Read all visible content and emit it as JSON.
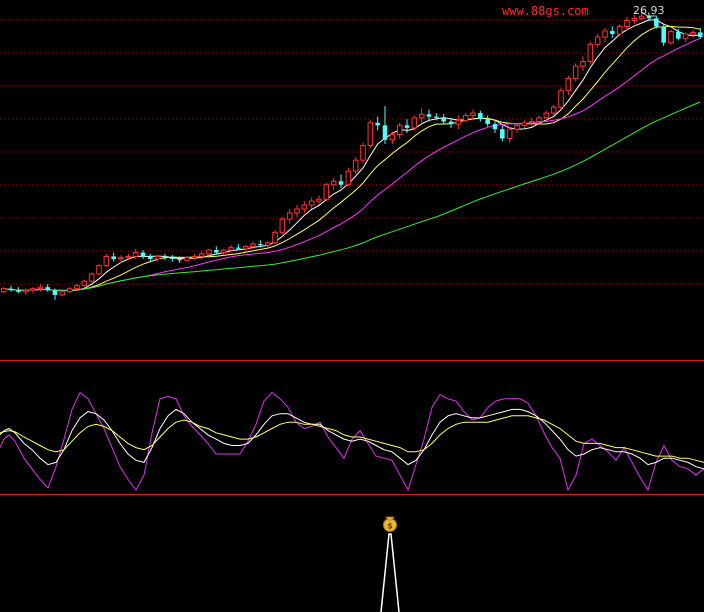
{
  "watermark": "www.88gs.com",
  "chart_data": [
    {
      "type": "candlestick",
      "panel": "price",
      "title": "",
      "peak_label": "26.93",
      "ylim": [
        5.0,
        27.2
      ],
      "grid": true,
      "candles": [
        [
          0,
          5.95,
          6.1,
          5.9,
          6.05
        ],
        [
          1,
          6.05,
          6.15,
          5.95,
          6.0
        ],
        [
          2,
          6.0,
          6.1,
          5.9,
          5.95
        ],
        [
          3,
          5.95,
          6.05,
          5.85,
          6.0
        ],
        [
          4,
          6.0,
          6.1,
          5.9,
          6.05
        ],
        [
          5,
          6.05,
          6.2,
          5.95,
          6.1
        ],
        [
          6,
          6.1,
          6.2,
          5.95,
          6.0
        ],
        [
          7,
          6.0,
          6.05,
          5.7,
          5.85
        ],
        [
          8,
          5.85,
          6.0,
          5.8,
          5.95
        ],
        [
          9,
          5.95,
          6.1,
          5.9,
          6.05
        ],
        [
          10,
          6.05,
          6.2,
          6.0,
          6.15
        ],
        [
          11,
          6.15,
          6.35,
          6.1,
          6.3
        ],
        [
          12,
          6.3,
          6.6,
          6.25,
          6.55
        ],
        [
          13,
          6.55,
          6.9,
          6.5,
          6.85
        ],
        [
          14,
          6.85,
          7.3,
          6.8,
          7.2
        ],
        [
          15,
          7.2,
          7.35,
          7.0,
          7.1
        ],
        [
          16,
          7.1,
          7.25,
          6.95,
          7.15
        ],
        [
          17,
          7.15,
          7.3,
          7.05,
          7.2
        ],
        [
          18,
          7.2,
          7.5,
          7.1,
          7.35
        ],
        [
          19,
          7.35,
          7.45,
          7.1,
          7.2
        ],
        [
          20,
          7.2,
          7.3,
          7.0,
          7.1
        ],
        [
          21,
          7.1,
          7.25,
          7.0,
          7.2
        ],
        [
          22,
          7.2,
          7.3,
          7.05,
          7.15
        ],
        [
          23,
          7.15,
          7.25,
          7.0,
          7.1
        ],
        [
          24,
          7.1,
          7.2,
          6.95,
          7.05
        ],
        [
          25,
          7.05,
          7.2,
          7.0,
          7.15
        ],
        [
          26,
          7.15,
          7.3,
          7.05,
          7.2
        ],
        [
          27,
          7.2,
          7.4,
          7.1,
          7.3
        ],
        [
          28,
          7.3,
          7.5,
          7.2,
          7.45
        ],
        [
          29,
          7.45,
          7.6,
          7.3,
          7.35
        ],
        [
          30,
          7.35,
          7.5,
          7.25,
          7.45
        ],
        [
          31,
          7.45,
          7.65,
          7.35,
          7.55
        ],
        [
          32,
          7.55,
          7.7,
          7.45,
          7.5
        ],
        [
          33,
          7.5,
          7.65,
          7.4,
          7.6
        ],
        [
          34,
          7.6,
          7.8,
          7.5,
          7.7
        ],
        [
          35,
          7.7,
          7.85,
          7.55,
          7.65
        ],
        [
          36,
          7.65,
          7.8,
          7.55,
          7.75
        ],
        [
          37,
          7.75,
          8.3,
          7.7,
          8.2
        ],
        [
          38,
          8.2,
          8.9,
          8.1,
          8.8
        ],
        [
          39,
          8.8,
          9.3,
          8.6,
          9.1
        ],
        [
          40,
          9.1,
          9.5,
          8.9,
          9.3
        ],
        [
          41,
          9.3,
          9.7,
          9.1,
          9.5
        ],
        [
          42,
          9.5,
          9.9,
          9.3,
          9.7
        ],
        [
          43,
          9.7,
          10.0,
          9.5,
          9.8
        ],
        [
          44,
          9.8,
          10.7,
          9.7,
          10.6
        ],
        [
          45,
          10.6,
          11.0,
          10.3,
          10.8
        ],
        [
          46,
          10.8,
          11.2,
          10.4,
          10.6
        ],
        [
          47,
          10.6,
          11.6,
          10.5,
          11.4
        ],
        [
          48,
          11.4,
          12.3,
          11.2,
          12.1
        ],
        [
          49,
          12.1,
          13.3,
          11.9,
          13.1
        ],
        [
          50,
          13.1,
          15.0,
          12.9,
          14.8
        ],
        [
          51,
          14.8,
          15.3,
          14.2,
          14.6
        ],
        [
          52,
          14.6,
          16.2,
          13.2,
          13.5
        ],
        [
          53,
          13.5,
          14.1,
          13.2,
          13.9
        ],
        [
          54,
          13.9,
          14.8,
          13.6,
          14.6
        ],
        [
          55,
          14.6,
          15.1,
          14.0,
          14.4
        ],
        [
          56,
          14.4,
          15.4,
          14.2,
          15.2
        ],
        [
          57,
          15.2,
          16.0,
          14.8,
          15.5
        ],
        [
          58,
          15.5,
          15.9,
          14.9,
          15.3
        ],
        [
          59,
          15.3,
          15.6,
          15.0,
          15.2
        ],
        [
          60,
          15.2,
          15.5,
          14.7,
          14.9
        ],
        [
          61,
          14.9,
          15.2,
          14.4,
          14.7
        ],
        [
          62,
          14.7,
          15.4,
          14.3,
          15.0
        ],
        [
          63,
          15.0,
          15.6,
          14.8,
          15.4
        ],
        [
          64,
          15.4,
          15.9,
          15.0,
          15.6
        ],
        [
          65,
          15.6,
          15.8,
          14.9,
          15.1
        ],
        [
          66,
          15.1,
          15.4,
          14.5,
          14.7
        ],
        [
          67,
          14.7,
          15.0,
          14.0,
          14.3
        ],
        [
          68,
          14.3,
          14.6,
          13.4,
          13.6
        ],
        [
          69,
          13.6,
          14.5,
          13.3,
          14.3
        ],
        [
          70,
          14.3,
          14.8,
          14.0,
          14.6
        ],
        [
          71,
          14.6,
          15.0,
          14.4,
          14.8
        ],
        [
          72,
          14.8,
          15.2,
          14.5,
          14.9
        ],
        [
          73,
          14.9,
          15.4,
          14.7,
          15.2
        ],
        [
          74,
          15.2,
          15.8,
          15.0,
          15.6
        ],
        [
          75,
          15.6,
          16.3,
          15.4,
          16.1
        ],
        [
          76,
          16.1,
          17.9,
          15.9,
          17.6
        ],
        [
          77,
          17.6,
          19.1,
          17.2,
          18.8
        ],
        [
          78,
          18.8,
          20.4,
          18.5,
          20.1
        ],
        [
          79,
          20.1,
          21.2,
          19.6,
          20.6
        ],
        [
          80,
          20.6,
          22.9,
          20.3,
          22.6
        ],
        [
          81,
          22.6,
          23.9,
          22.2,
          23.5
        ],
        [
          82,
          23.5,
          24.7,
          22.9,
          24.3
        ],
        [
          83,
          24.3,
          24.9,
          23.4,
          23.9
        ],
        [
          84,
          23.9,
          25.2,
          23.6,
          24.9
        ],
        [
          85,
          24.9,
          26.2,
          24.4,
          25.7
        ],
        [
          86,
          25.7,
          26.5,
          25.2,
          26.0
        ],
        [
          87,
          26.0,
          26.9,
          25.7,
          26.3
        ],
        [
          88,
          26.3,
          26.7,
          25.6,
          26.0
        ],
        [
          89,
          26.0,
          26.4,
          24.6,
          24.9
        ],
        [
          90,
          24.9,
          25.3,
          22.4,
          22.8
        ],
        [
          91,
          22.8,
          24.4,
          22.5,
          24.2
        ],
        [
          92,
          24.2,
          24.6,
          23.1,
          23.3
        ],
        [
          93,
          23.3,
          24.1,
          22.9,
          23.9
        ],
        [
          94,
          23.9,
          24.4,
          23.4,
          24.1
        ],
        [
          95,
          24.1,
          24.7,
          23.3,
          23.5
        ]
      ],
      "moving_averages": [
        {
          "color": "#ffffff",
          "period": 5
        },
        {
          "color": "#ffff66",
          "period": 10
        },
        {
          "color": "#ff33ff",
          "period": 20
        },
        {
          "color": "#33ee33",
          "period": 60
        }
      ],
      "colors": {
        "up": "#ff3333",
        "down": "#54fcfc",
        "border": "#cc0000",
        "grid": "#aa0000"
      }
    },
    {
      "type": "line",
      "panel": "oscillator",
      "title": "",
      "ylim": [
        0,
        100
      ],
      "x": [
        0,
        4,
        9,
        15,
        24,
        32,
        40,
        48,
        56,
        64,
        72,
        80,
        88,
        96,
        104,
        112,
        120,
        128,
        136,
        144,
        152,
        160,
        168,
        176,
        184,
        192,
        200,
        208,
        216,
        224,
        232,
        240,
        248,
        256,
        264,
        272,
        280,
        288,
        296,
        304,
        312,
        320,
        328,
        336,
        344,
        352,
        360,
        368,
        376,
        384,
        392,
        400,
        408,
        416,
        424,
        432,
        440,
        448,
        456,
        464,
        472,
        480,
        488,
        496,
        504,
        512,
        520,
        528,
        536,
        544,
        552,
        560,
        568,
        576,
        584,
        592,
        600,
        608,
        616,
        624,
        632,
        640,
        648,
        656,
        664,
        672,
        680,
        688,
        696,
        704
      ],
      "series": [
        {
          "color": "#dd33ee",
          "values": [
            40,
            48,
            52,
            46,
            30,
            20,
            10,
            2,
            22,
            48,
            76,
            92,
            86,
            72,
            58,
            40,
            22,
            10,
            0,
            14,
            54,
            86,
            88,
            86,
            70,
            60,
            52,
            44,
            34,
            34,
            34,
            34,
            46,
            62,
            84,
            92,
            86,
            78,
            64,
            58,
            60,
            64,
            50,
            40,
            30,
            48,
            56,
            44,
            32,
            30,
            28,
            14,
            0,
            24,
            48,
            78,
            90,
            86,
            84,
            74,
            66,
            68,
            78,
            84,
            86,
            86,
            86,
            82,
            70,
            54,
            40,
            30,
            0,
            14,
            44,
            48,
            42,
            36,
            28,
            40,
            26,
            12,
            0,
            26,
            42,
            28,
            22,
            20,
            14,
            20
          ]
        },
        {
          "color": "#ffffff",
          "values": [
            52,
            56,
            58,
            54,
            44,
            38,
            30,
            24,
            26,
            38,
            56,
            68,
            74,
            72,
            66,
            56,
            44,
            34,
            28,
            26,
            40,
            58,
            70,
            76,
            72,
            64,
            58,
            52,
            48,
            44,
            42,
            42,
            44,
            52,
            62,
            70,
            72,
            72,
            68,
            64,
            62,
            62,
            56,
            52,
            48,
            46,
            48,
            46,
            42,
            38,
            36,
            30,
            24,
            28,
            38,
            52,
            64,
            70,
            72,
            70,
            68,
            68,
            70,
            72,
            74,
            76,
            76,
            74,
            70,
            64,
            56,
            48,
            38,
            32,
            34,
            38,
            40,
            38,
            36,
            36,
            34,
            30,
            24,
            26,
            30,
            30,
            28,
            26,
            22,
            20
          ]
        },
        {
          "color": "#ffff66",
          "values": [
            54,
            55,
            56,
            55,
            50,
            46,
            42,
            38,
            36,
            38,
            46,
            54,
            60,
            62,
            60,
            56,
            50,
            44,
            40,
            38,
            42,
            50,
            58,
            64,
            66,
            64,
            60,
            58,
            54,
            52,
            50,
            48,
            48,
            50,
            54,
            58,
            62,
            64,
            64,
            62,
            62,
            60,
            58,
            56,
            52,
            50,
            50,
            48,
            46,
            44,
            42,
            40,
            36,
            36,
            38,
            44,
            52,
            58,
            62,
            64,
            64,
            64,
            64,
            66,
            68,
            70,
            70,
            70,
            68,
            66,
            62,
            58,
            52,
            46,
            44,
            44,
            44,
            42,
            40,
            40,
            38,
            36,
            34,
            32,
            32,
            32,
            30,
            30,
            28,
            26
          ]
        }
      ],
      "reference_lines": [
        {
          "color": "#cc2222"
        }
      ]
    },
    {
      "type": "signal",
      "panel": "signal",
      "title": "",
      "signal_index": 390,
      "icon": "money-bag-icon",
      "color": "#ffffff"
    }
  ]
}
